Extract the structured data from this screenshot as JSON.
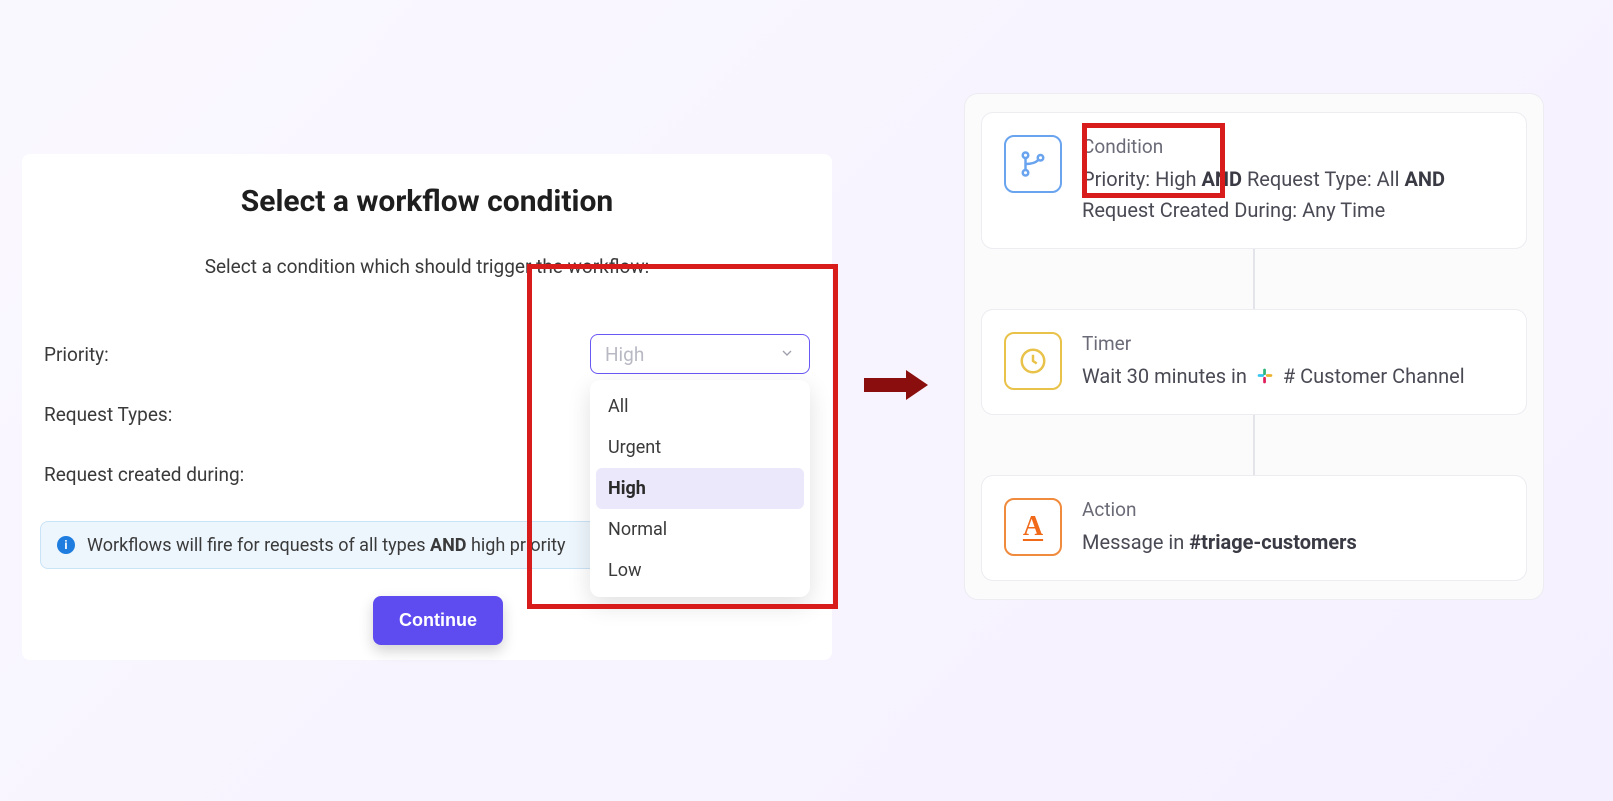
{
  "form": {
    "title": "Select a workflow condition",
    "subtitle": "Select a condition which should trigger the workflow:",
    "labels": {
      "priority": "Priority:",
      "request_types": "Request Types:",
      "request_created_during": "Request created during:"
    },
    "priority_select": {
      "value": "High",
      "options": [
        "All",
        "Urgent",
        "High",
        "Normal",
        "Low"
      ]
    },
    "info_prefix": "Workflows will fire for requests of all types",
    "info_and": "AND",
    "info_suffix": "high priority",
    "continue_label": "Continue"
  },
  "workflow": {
    "condition": {
      "title": "Condition",
      "p1": "Priority: High",
      "and1": "AND",
      "p2": "Request Type: All",
      "and2": "AND",
      "p3": "Request Created During: Any Time"
    },
    "timer": {
      "title": "Timer",
      "text_prefix": "Wait 30 minutes in",
      "text_suffix": "# Customer Channel"
    },
    "action": {
      "title": "Action",
      "text_prefix": "Message in",
      "channel": "#triage-customers"
    }
  }
}
